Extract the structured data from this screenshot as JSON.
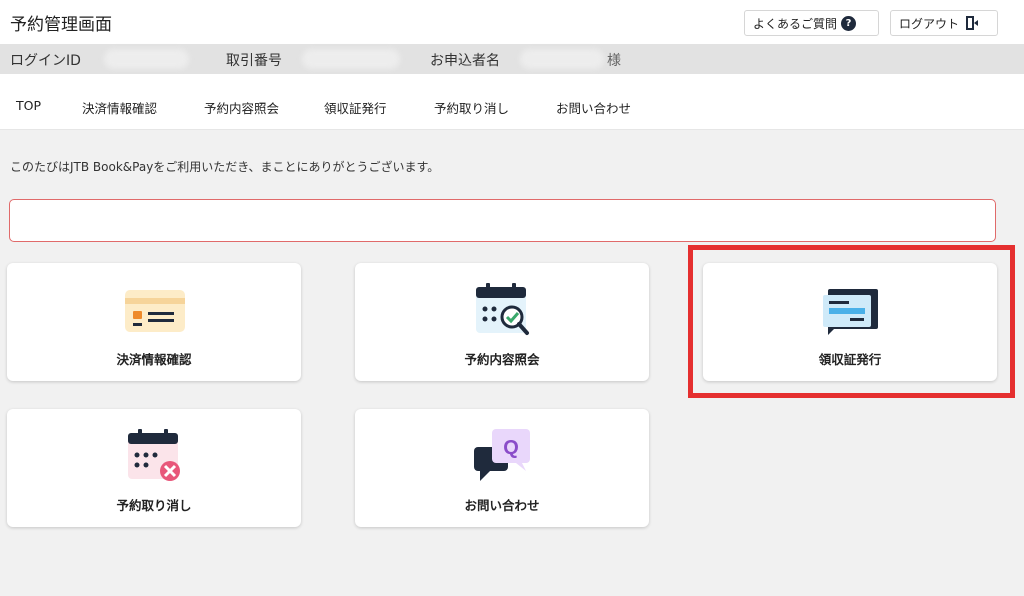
{
  "header": {
    "title": "予約管理画面",
    "faq_label": "よくあるご質問",
    "logout_label": "ログアウト"
  },
  "info": {
    "login_id_label": "ログインID",
    "transaction_no_label": "取引番号",
    "applicant_label": "お申込者名",
    "applicant_suffix": "様"
  },
  "nav": {
    "items": [
      "TOP",
      "決済情報確認",
      "予約内容照会",
      "領収証発行",
      "予約取り消し",
      "お問い合わせ"
    ]
  },
  "main": {
    "welcome": "このたびはJTB Book&Payをご利用いただき、まことにありがとうございます。",
    "cards": [
      {
        "label": "決済情報確認",
        "icon": "payment-card-icon"
      },
      {
        "label": "予約内容照会",
        "icon": "calendar-search-icon"
      },
      {
        "label": "領収証発行",
        "icon": "receipt-icon"
      },
      {
        "label": "予約取り消し",
        "icon": "calendar-cancel-icon"
      },
      {
        "label": "お問い合わせ",
        "icon": "chat-question-icon"
      }
    ]
  },
  "colors": {
    "highlight": "#e52f2f",
    "notice_border": "#e06a6a",
    "icon_navy": "#1f2a3c",
    "icon_blue": "#4ab0e8"
  }
}
